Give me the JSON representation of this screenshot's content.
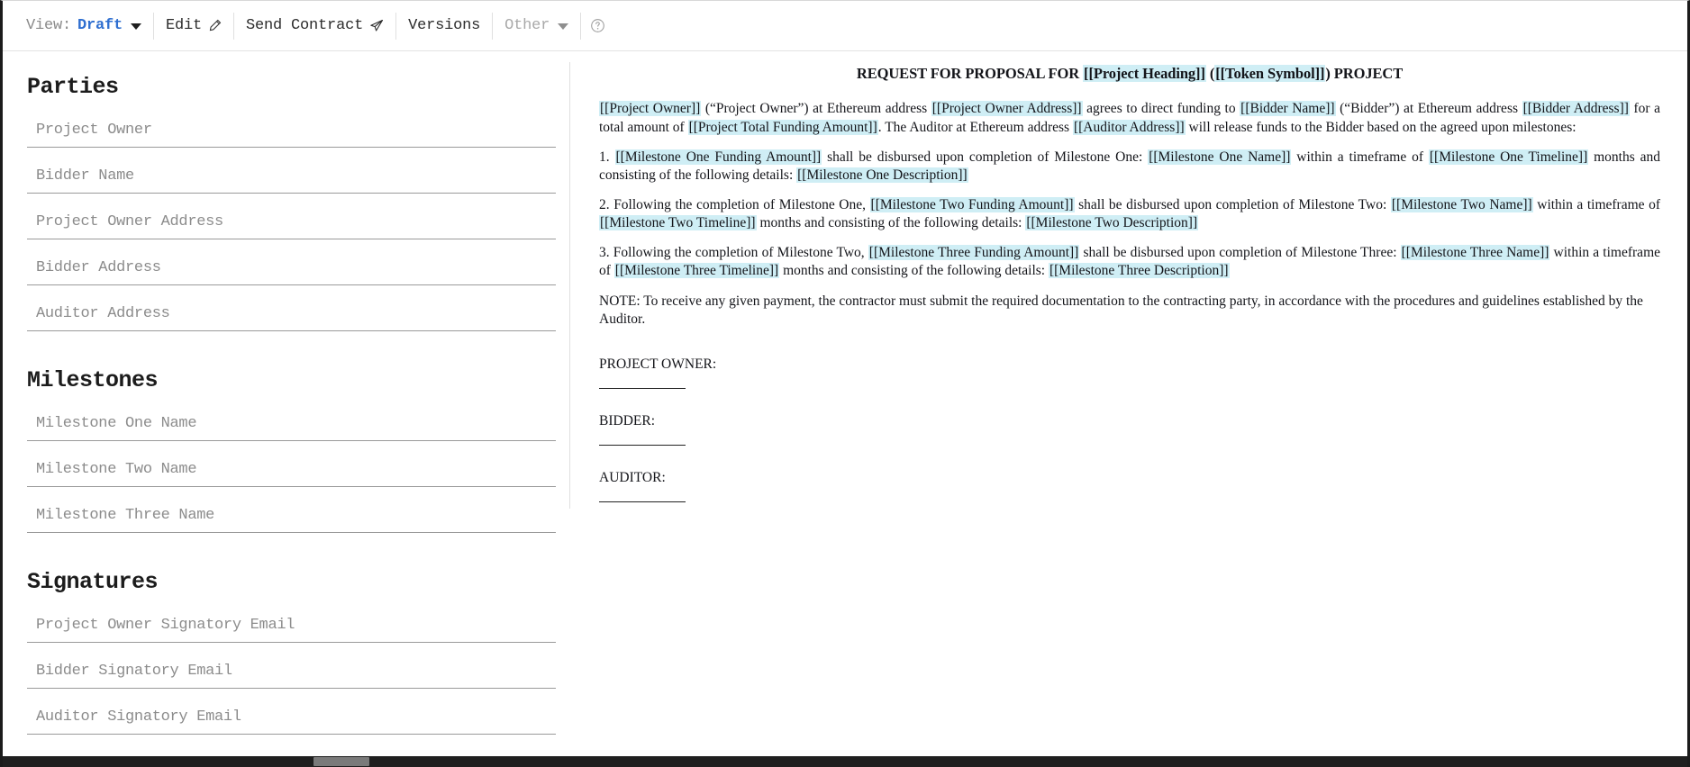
{
  "toolbar": {
    "view_label": "View:",
    "view_value": "Draft",
    "edit_label": "Edit",
    "edit_icon": "pencil-icon",
    "send_contract_label": "Send Contract",
    "send_icon": "paper-plane-icon",
    "versions_label": "Versions",
    "other_label": "Other",
    "help_icon": "question-circle-icon",
    "accent_color": "#2f6fd0",
    "muted_color": "#8b8b8b"
  },
  "form": {
    "sections": [
      {
        "title": "Parties",
        "fields": [
          {
            "placeholder": "Project Owner",
            "value": "",
            "name": "project-owner"
          },
          {
            "placeholder": "Bidder Name",
            "value": "",
            "name": "bidder-name"
          },
          {
            "placeholder": "Project Owner Address",
            "value": "",
            "name": "project-owner-address"
          },
          {
            "placeholder": "Bidder Address",
            "value": "",
            "name": "bidder-address"
          },
          {
            "placeholder": "Auditor Address",
            "value": "",
            "name": "auditor-address"
          }
        ]
      },
      {
        "title": "Milestones",
        "fields": [
          {
            "placeholder": "Milestone One Name",
            "value": "",
            "name": "milestone-one-name"
          },
          {
            "placeholder": "Milestone Two Name",
            "value": "",
            "name": "milestone-two-name"
          },
          {
            "placeholder": "Milestone Three Name",
            "value": "",
            "name": "milestone-three-name"
          }
        ]
      },
      {
        "title": "Signatures",
        "fields": [
          {
            "placeholder": "Project Owner Signatory Email",
            "value": "",
            "name": "project-owner-signatory-email"
          },
          {
            "placeholder": "Bidder Signatory Email",
            "value": "",
            "name": "bidder-signatory-email"
          },
          {
            "placeholder": "Auditor Signatory Email",
            "value": "",
            "name": "auditor-signatory-email"
          }
        ]
      }
    ]
  },
  "document": {
    "title_prefix": "REQUEST FOR PROPOSAL FOR ",
    "title_token_1": "[[Project Heading]]",
    "title_mid": " (",
    "title_token_2": "[[Token Symbol]]",
    "title_suffix": ") PROJECT",
    "lead": {
      "t1": "[[Project Owner]]",
      "s1": " (“Project Owner”) at Ethereum address ",
      "t2": "[[Project Owner Address]]",
      "s2": " agrees to direct funding to ",
      "t3": "[[Bidder Name]]",
      "s3": " (“Bidder”) at Ethereum address ",
      "t4": "[[Bidder Address]]",
      "s4": " for a total amount of ",
      "t5": "[[Project Total Funding Amount]]",
      "s5": ". The Auditor at Ethereum address ",
      "t6": "[[Auditor Address]]",
      "s6": " will release funds to the Bidder based on the agreed upon milestones:"
    },
    "milestone_1": {
      "num": "1. ",
      "t1": "[[Milestone One Funding Amount]]",
      "s1": " shall be disbursed upon completion of Milestone One: ",
      "t2": "[[Milestone One Name]]",
      "s2": " within a timeframe of ",
      "t3": "[[Milestone One Timeline]]",
      "s3": " months and consisting of the following details: ",
      "t4": "[[Milestone One Description]]"
    },
    "milestone_2": {
      "num": "2. ",
      "s0": "Following the completion of Milestone One, ",
      "t1": "[[Milestone Two Funding Amount]]",
      "s1": " shall be disbursed upon completion of Milestone Two: ",
      "t2": "[[Milestone Two Name]]",
      "s2": " within a timeframe of ",
      "t3": "[[Milestone Two Timeline]]",
      "s3": " months and consisting of the following details: ",
      "t4": "[[Milestone Two Description]]"
    },
    "milestone_3": {
      "num": "3. ",
      "s0": "Following the completion of Milestone Two, ",
      "t1": "[[Milestone Three Funding Amount]]",
      "s1": " shall be disbursed upon completion of Milestone Three: ",
      "t2": "[[Milestone Three Name]]",
      "s2": " within a timeframe of ",
      "t3": "[[Milestone Three Timeline]]",
      "s3": " months and consisting of the following details: ",
      "t4": "[[Milestone Three Description]]"
    },
    "note": "NOTE: To receive any given payment, the contractor must submit the required documentation to the contracting party, in accordance with the procedures and guidelines established by the Auditor.",
    "signatures": [
      {
        "label": "PROJECT OWNER:",
        "name": "project-owner"
      },
      {
        "label": "BIDDER:",
        "name": "bidder"
      },
      {
        "label": "AUDITOR:",
        "name": "auditor"
      }
    ],
    "token_highlight_color": "#cfeef5"
  }
}
